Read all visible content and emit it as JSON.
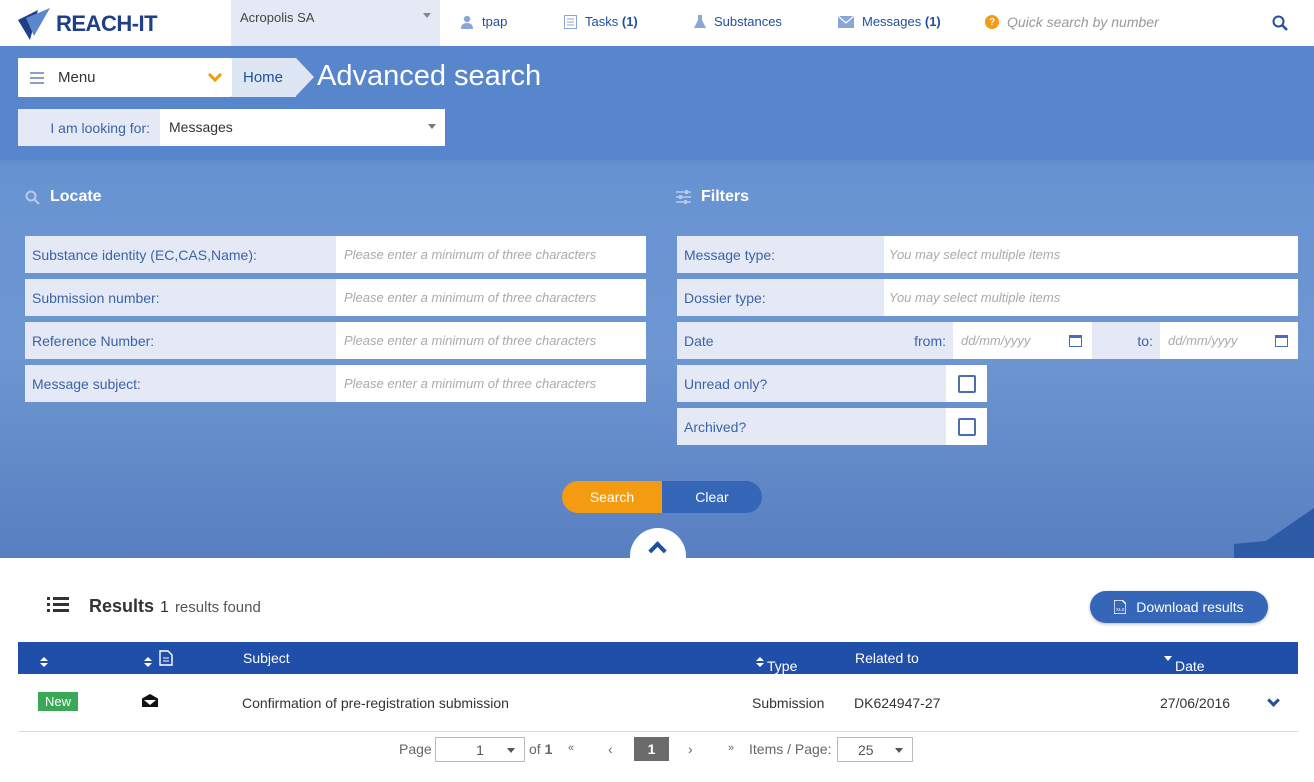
{
  "app": {
    "logo_text": "REACH-IT"
  },
  "topbar": {
    "company": "Acropolis SA",
    "user": "tpap",
    "tasks_label": "Tasks",
    "tasks_count": "(1)",
    "substances_label": "Substances",
    "messages_label": "Messages",
    "messages_count": "(1)",
    "quick_search_placeholder": "Quick search by number"
  },
  "header": {
    "menu_label": "Menu",
    "breadcrumb_home": "Home",
    "page_title": "Advanced search",
    "looking_for_label": "I am looking for:",
    "looking_for_value": "Messages"
  },
  "locate": {
    "title": "Locate",
    "fields": [
      {
        "label": "Substance identity (EC,CAS,Name):",
        "placeholder": "Please enter a minimum of three characters"
      },
      {
        "label": "Submission number:",
        "placeholder": "Please enter a minimum of three characters"
      },
      {
        "label": "Reference Number:",
        "placeholder": "Please enter a minimum of three characters"
      },
      {
        "label": "Message subject:",
        "placeholder": "Please enter a minimum of three characters"
      }
    ]
  },
  "filters": {
    "title": "Filters",
    "message_type_label": "Message type:",
    "message_type_placeholder": "You may select multiple items",
    "dossier_type_label": "Dossier type:",
    "dossier_type_placeholder": "You may select multiple items",
    "date_label": "Date",
    "from_label": "from:",
    "to_label": "to:",
    "date_placeholder": "dd/mm/yyyy",
    "unread_label": "Unread only?",
    "archived_label": "Archived?"
  },
  "actions": {
    "search_label": "Search",
    "clear_label": "Clear"
  },
  "results": {
    "title": "Results",
    "count": "1",
    "found_text": "results found",
    "download_label": "Download results",
    "columns": {
      "subject": "Subject",
      "type": "Type",
      "related": "Related to",
      "date": "Date"
    },
    "rows": [
      {
        "status": "New",
        "subject": "Confirmation of pre-registration submission",
        "type": "Submission",
        "related": "DK624947-27",
        "date": "27/06/2016"
      }
    ]
  },
  "pagination": {
    "page_label": "Page",
    "page_value": "1",
    "of_label": "of",
    "total_pages": "1",
    "first": "«",
    "prev": "‹",
    "current": "1",
    "next": "›",
    "last": "»",
    "items_label": "Items / Page:",
    "items_value": "25"
  },
  "colors": {
    "accent": "#f39c12",
    "primary": "#1f4fa8",
    "hero": "#5b87cd",
    "new_badge": "#3aa856"
  }
}
